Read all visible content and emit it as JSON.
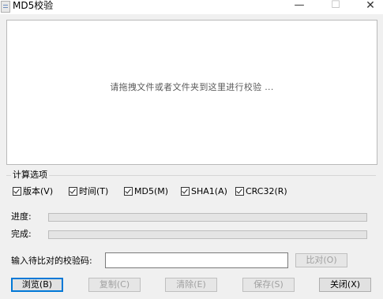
{
  "window": {
    "title": "MD5校验",
    "minimize": "—",
    "maximize": "☐",
    "close": "✕"
  },
  "drop_area": {
    "hint": "请拖拽文件或者文件夹到这里进行校验 ..."
  },
  "options": {
    "group_title": "计算选项",
    "items": [
      {
        "label": "版本(V)",
        "checked": true
      },
      {
        "label": "时间(T)",
        "checked": true
      },
      {
        "label": "MD5(M)",
        "checked": true
      },
      {
        "label": "SHA1(A)",
        "checked": true
      },
      {
        "label": "CRC32(R)",
        "checked": true
      }
    ]
  },
  "progress": {
    "progress_label": "进度:",
    "progress_value": 0,
    "complete_label": "完成:",
    "complete_value": 0
  },
  "compare": {
    "label": "输入待比对的校验码:",
    "value": "",
    "button": "比对(O)"
  },
  "buttons": {
    "browse": "浏览(B)",
    "copy": "复制(C)",
    "clear": "清除(E)",
    "save": "保存(S)",
    "close": "关闭(X)"
  },
  "colors": {
    "window_bg": "#f0f0f0",
    "drop_bg": "#ffffff",
    "accent": "#0078d7"
  }
}
